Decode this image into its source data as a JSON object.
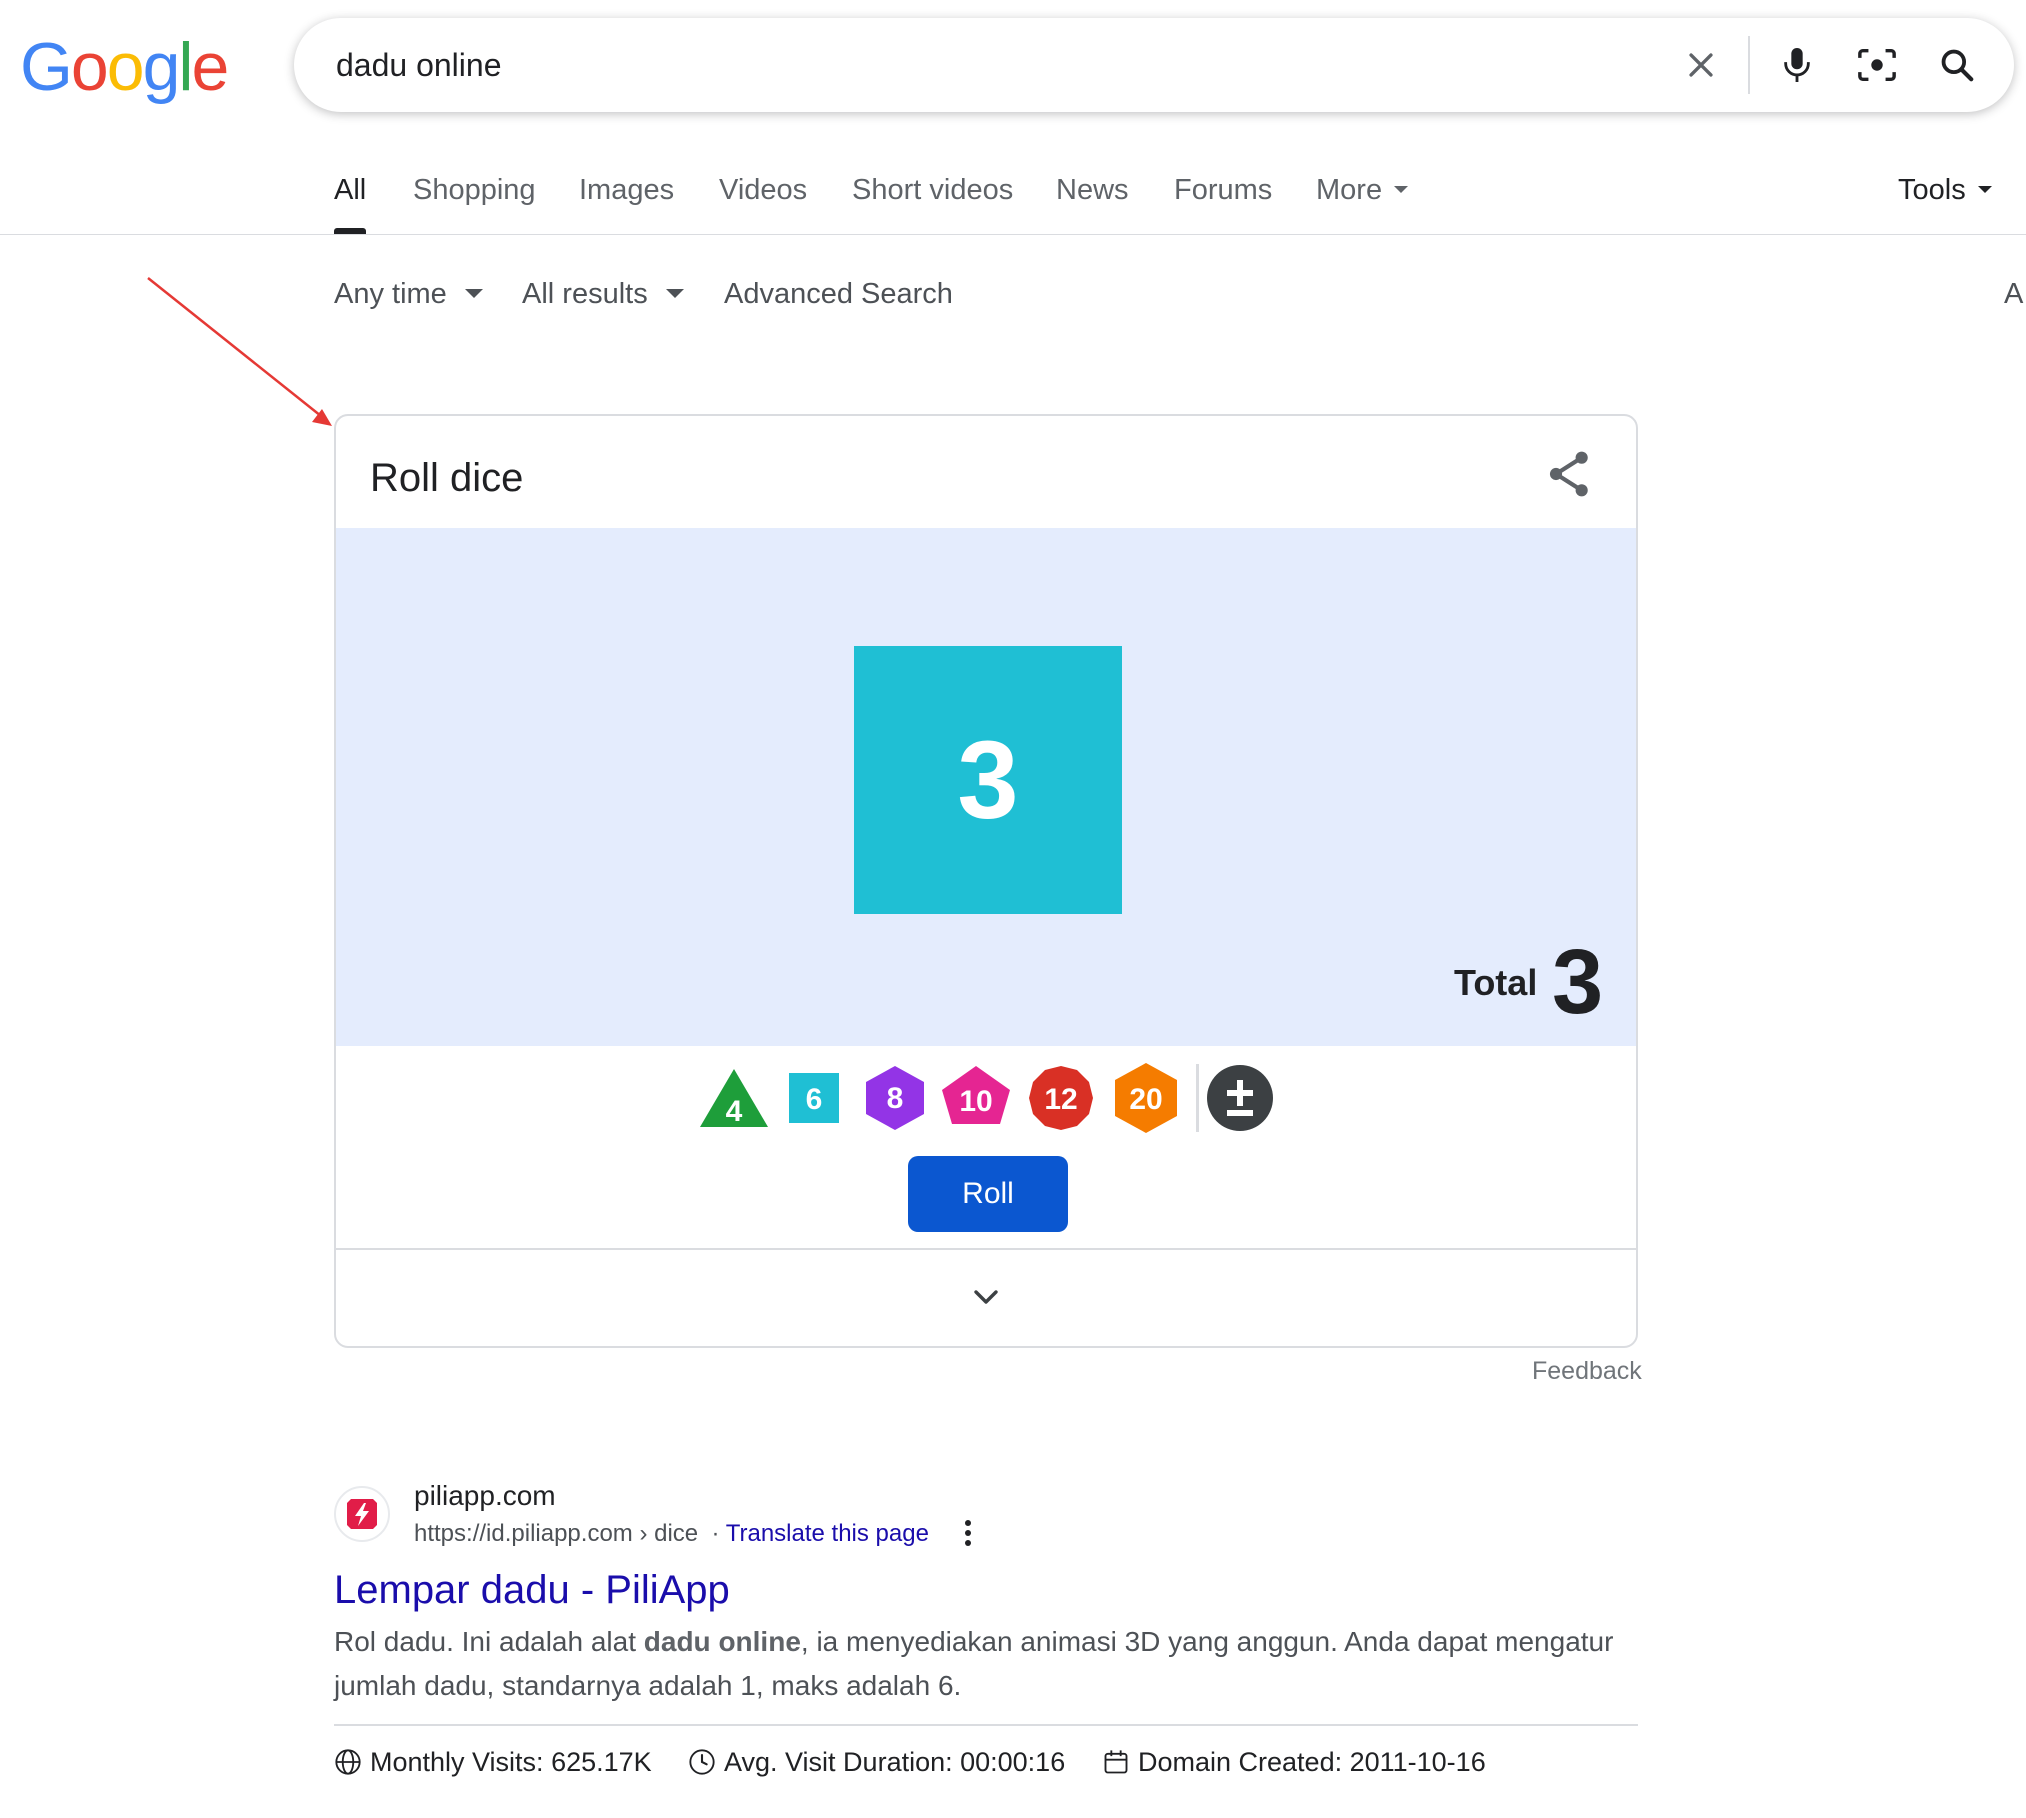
{
  "header": {
    "logo": [
      "G",
      "o",
      "o",
      "g",
      "l",
      "e"
    ],
    "logo_colors": [
      "#4285f4",
      "#ea4335",
      "#fbbc05",
      "#4285f4",
      "#34a853",
      "#ea4335"
    ],
    "search_query": "dadu online"
  },
  "tabs": {
    "items": [
      "All",
      "Shopping",
      "Images",
      "Videos",
      "Short videos",
      "News",
      "Forums",
      "More"
    ],
    "active": "All",
    "tools_label": "Tools"
  },
  "filters": {
    "time": "Any time",
    "results": "All results",
    "advanced": "Advanced Search",
    "edge_letter": "A"
  },
  "widget": {
    "title": "Roll dice",
    "die_value": "3",
    "die_color": "#1fbfd4",
    "total_label": "Total",
    "total_value": "3",
    "dice_types": [
      {
        "label": "4",
        "shape": "triangle",
        "color": "#1e9e3a"
      },
      {
        "label": "6",
        "shape": "square",
        "color": "#1fbfd4"
      },
      {
        "label": "8",
        "shape": "hexagon",
        "color": "#9334e6"
      },
      {
        "label": "10",
        "shape": "diamond",
        "color": "#e52592"
      },
      {
        "label": "12",
        "shape": "dodecagon",
        "color": "#d93025"
      },
      {
        "label": "20",
        "shape": "hexagon",
        "color": "#f57c00"
      }
    ],
    "roll_label": "Roll",
    "feedback": "Feedback"
  },
  "result": {
    "site_name": "piliapp.com",
    "url": "https://id.piliapp.com › dice",
    "translate": "Translate this page",
    "title": "Lempar dadu - PiliApp",
    "snippet_pre": "Rol dadu. Ini adalah alat ",
    "snippet_bold": "dadu online",
    "snippet_post": ", ia menyediakan animasi 3D yang anggun. Anda dapat mengatur jumlah dadu, standarnya adalah 1, maks adalah 6.",
    "stats": {
      "visits": "Monthly Visits: 625.17K",
      "duration": "Avg. Visit Duration: 00:00:16",
      "created": "Domain Created: 2011-10-16"
    }
  }
}
